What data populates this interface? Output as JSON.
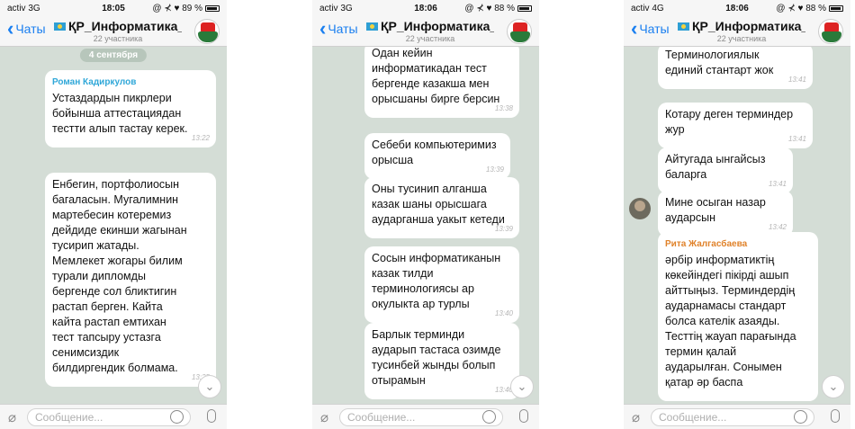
{
  "screens": [
    {
      "status": {
        "carrier": "activ  3G",
        "time": "18:05",
        "battery": "@ ⊀ ♥ 89 %",
        "battery_fill": 0.89
      },
      "nav": {
        "back": "Чаты",
        "title": "ҚР_Информатика_...",
        "subtitle": "22 участника"
      },
      "date_chip": "4 сентября",
      "messages": [
        {
          "sender": "Роман Кадиркулов",
          "sender_color": "#2fa7d8",
          "text": "Устаздардын пикрлери\nбойынша аттестациядан\nтестти алып тастау керек.",
          "time": "13:22"
        },
        {
          "sender": "",
          "text": "Енбегин, портфолиосын\nбагаласын. Мугалимнин\nмартебесин котеремиз\nдейдиде екинши жагынан\nтусирип жатады.\nМемлекет жогары билим\nтурали дипломды\nбергенде сол бликтигин\nрастап берген. Кайта\nкайта растап емтихан\nтест тапсыру устазга\nсенимсиздик\nбилдиргендик болмама.",
          "time": "13:25"
        }
      ],
      "input_placeholder": "Сообщение..."
    },
    {
      "status": {
        "carrier": "activ  3G",
        "time": "18:06",
        "battery": "@ ⊀ ♥ 88 %",
        "battery_fill": 0.88
      },
      "nav": {
        "back": "Чаты",
        "title": "ҚР_Информатика_...",
        "subtitle": "22 участника"
      },
      "messages": [
        {
          "text": "Одан кейин\nинформатикадан тест\nбергенде казакша мен\nорысшаны бирге берсин",
          "time": "13:38"
        },
        {
          "text": "Себеби компьютеримиз\nорысша",
          "time": "13:39"
        },
        {
          "text": "Оны тусинип алганша\nказак шаны орысшага\nаударганша уакыт кетеди",
          "time": "13:39"
        },
        {
          "text": "Сосын информатиканын\nказак тилди\nтерминологиясы ар\nокулыкта ар турлы",
          "time": "13:40"
        },
        {
          "text": "Барлык терминди\nаударып тастаса озимде\nтусинбей жынды болып\nотырамын",
          "time": "13:40"
        }
      ],
      "input_placeholder": "Сообщение..."
    },
    {
      "status": {
        "carrier": "activ  4G",
        "time": "18:06",
        "battery": "@ ⊀ ♥ 88 %",
        "battery_fill": 0.88
      },
      "nav": {
        "back": "Чаты",
        "title": "ҚР_Информатика_...",
        "subtitle": "22 участника"
      },
      "messages": [
        {
          "text": "Терминологиялык\nединий стантарт жок",
          "time": "13:41"
        },
        {
          "text": "Котару деген терминдер\nжур",
          "time": "13:41"
        },
        {
          "text": "Айтугада ынгайсыз\nбаларга",
          "time": "13:41"
        },
        {
          "text": "Мине осыган назар\nаударсын",
          "time": "13:42"
        },
        {
          "sender": "Рита Жалгасбаева",
          "sender_color": "#e0822a",
          "text": "әрбір информатиктің\nкөкейіндегі пікірді ашып\nайттыңыз. Терминдердің\nаударнамасы  стандарт\nболса кателік азаяды.\nТесттің жауап парағында\nтермин қалай\nаударылған. Сонымен\nқатар әр баспа",
          "time": ""
        }
      ],
      "input_placeholder": "Сообщение..."
    }
  ]
}
